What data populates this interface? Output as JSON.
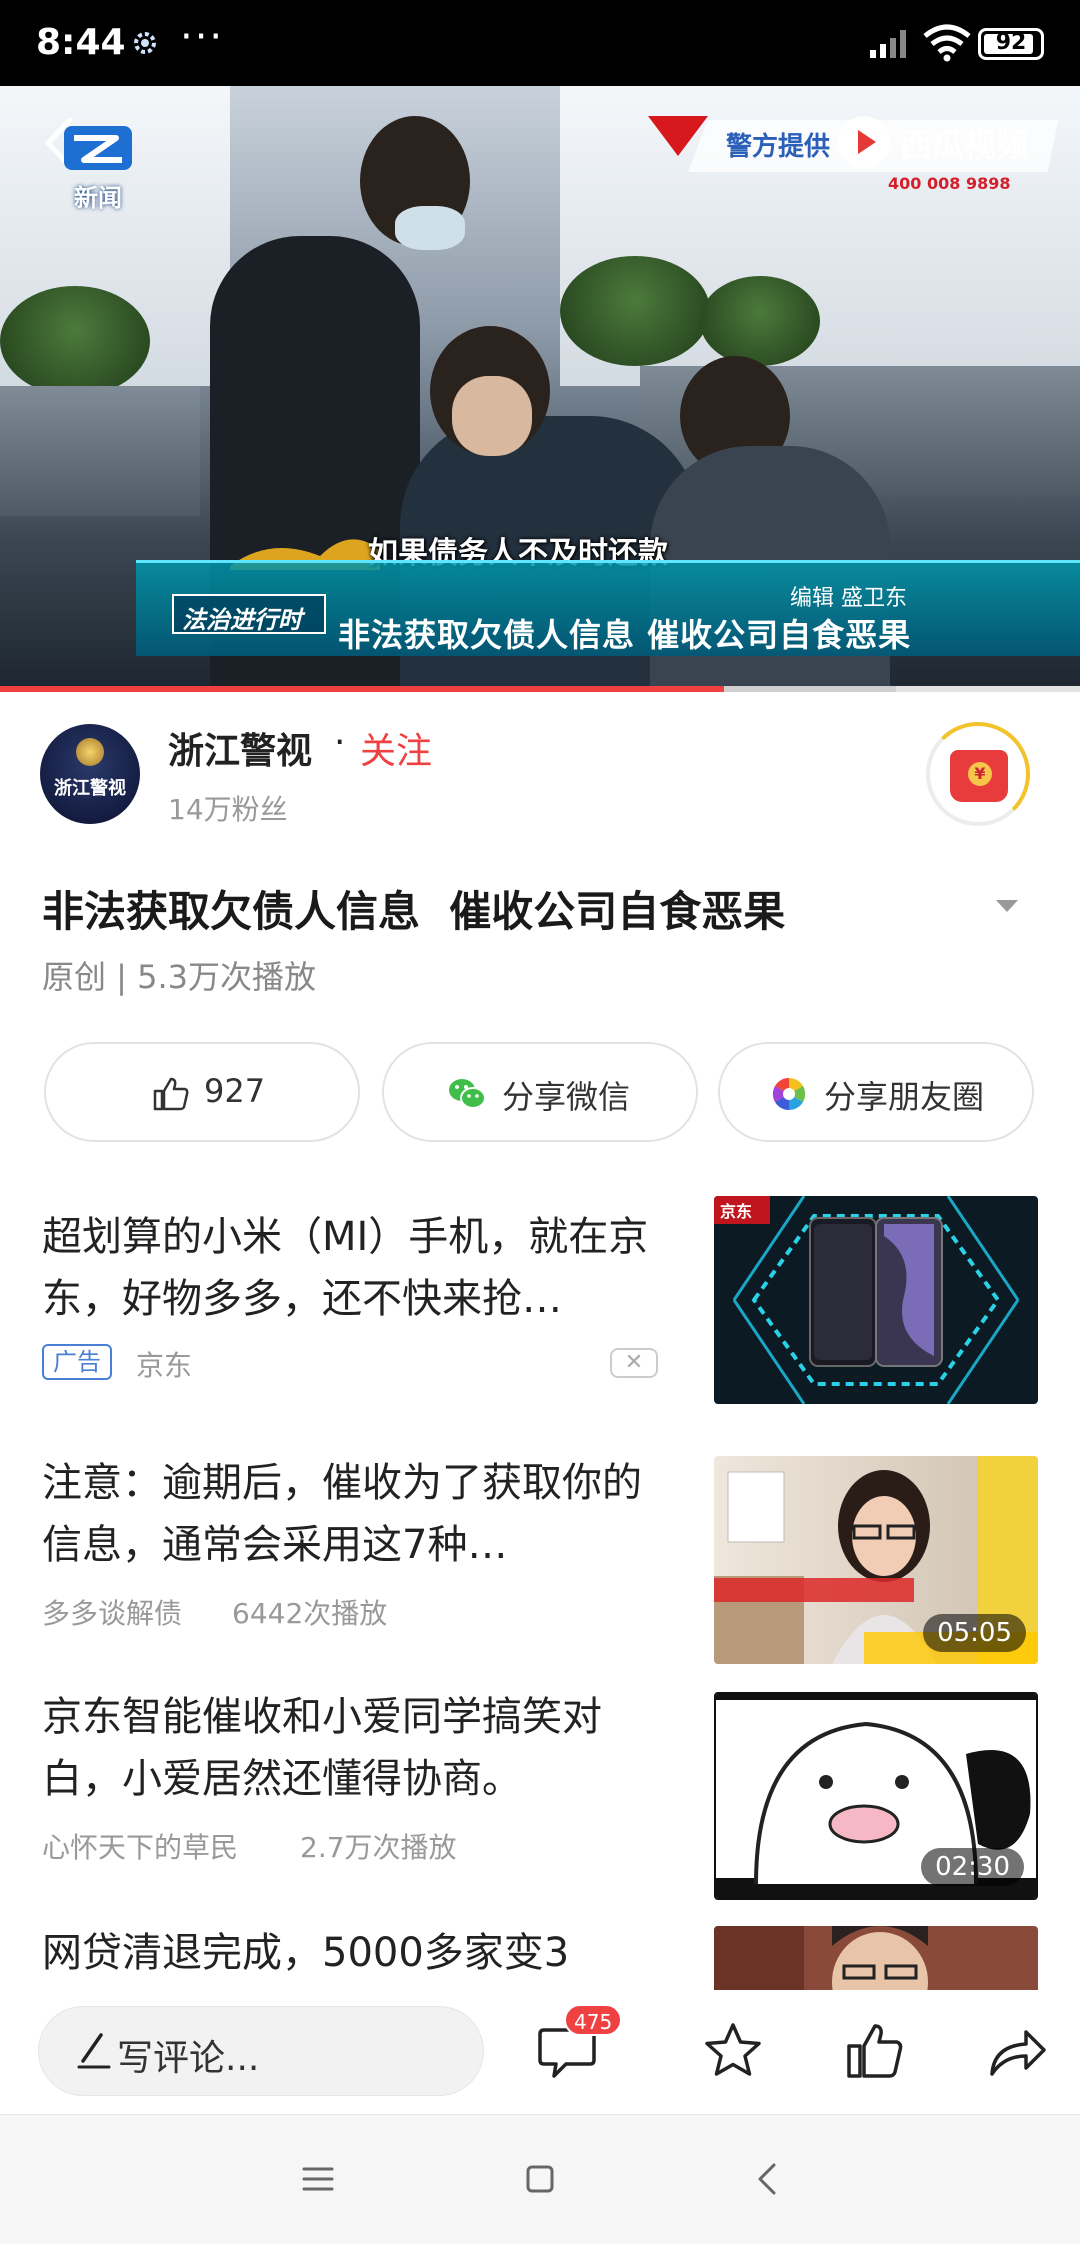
{
  "status_bar": {
    "time": "8:44",
    "dots": "···",
    "battery": "92",
    "battery_level": 0.92,
    "icons": [
      "settings-gear-icon",
      "signal-icon",
      "wifi-icon",
      "battery-icon"
    ]
  },
  "video": {
    "channel_logo_text": "新闻",
    "source_banner": "警方提供",
    "watermark": "西瓜视频",
    "hotline": "400 008 9898",
    "subtitle": "如果债务人不及时还款",
    "show_name": "法治进行时",
    "editor": "编辑   盛卫东",
    "headline": "非法获取欠债人信息   催收公司自食恶果",
    "progress": 0.67,
    "buffered": 0.83
  },
  "author": {
    "avatar_text": "浙江警视",
    "name": "浙江警视",
    "separator": "·",
    "follow": "关注",
    "fans": "14万粉丝"
  },
  "post": {
    "title": "非法获取欠债人信息  催收公司自食恶果",
    "meta": "原创 | 5.3万次播放"
  },
  "actions": {
    "like_count": "927",
    "share_wechat": "分享微信",
    "share_moments": "分享朋友圈"
  },
  "feed": [
    {
      "title": "超划算的小米（MI）手机，就在京东，好物多多，还不快来抢…",
      "ad_label": "广告",
      "source": "京东",
      "close": "✕",
      "thumb_brand": "京东"
    },
    {
      "title": "注意：逾期后，催收为了获取你的信息，通常会采用这7种…",
      "author": "多多谈解债",
      "plays": "6442次播放",
      "duration": "05:05"
    },
    {
      "title": "京东智能催收和小爱同学搞笑对白，小爱居然还懂得协商。",
      "author": "心怀天下的草民",
      "plays": "2.7万次播放",
      "duration": "02:30"
    },
    {
      "title": "网贷清退完成，5000多家变3"
    }
  ],
  "toolbar": {
    "comment_placeholder": "写评论...",
    "comment_count": "475"
  },
  "colors": {
    "accent": "#f04142",
    "text_primary": "#222222",
    "text_secondary": "#999999",
    "ad_blue": "#4a7fd6"
  }
}
